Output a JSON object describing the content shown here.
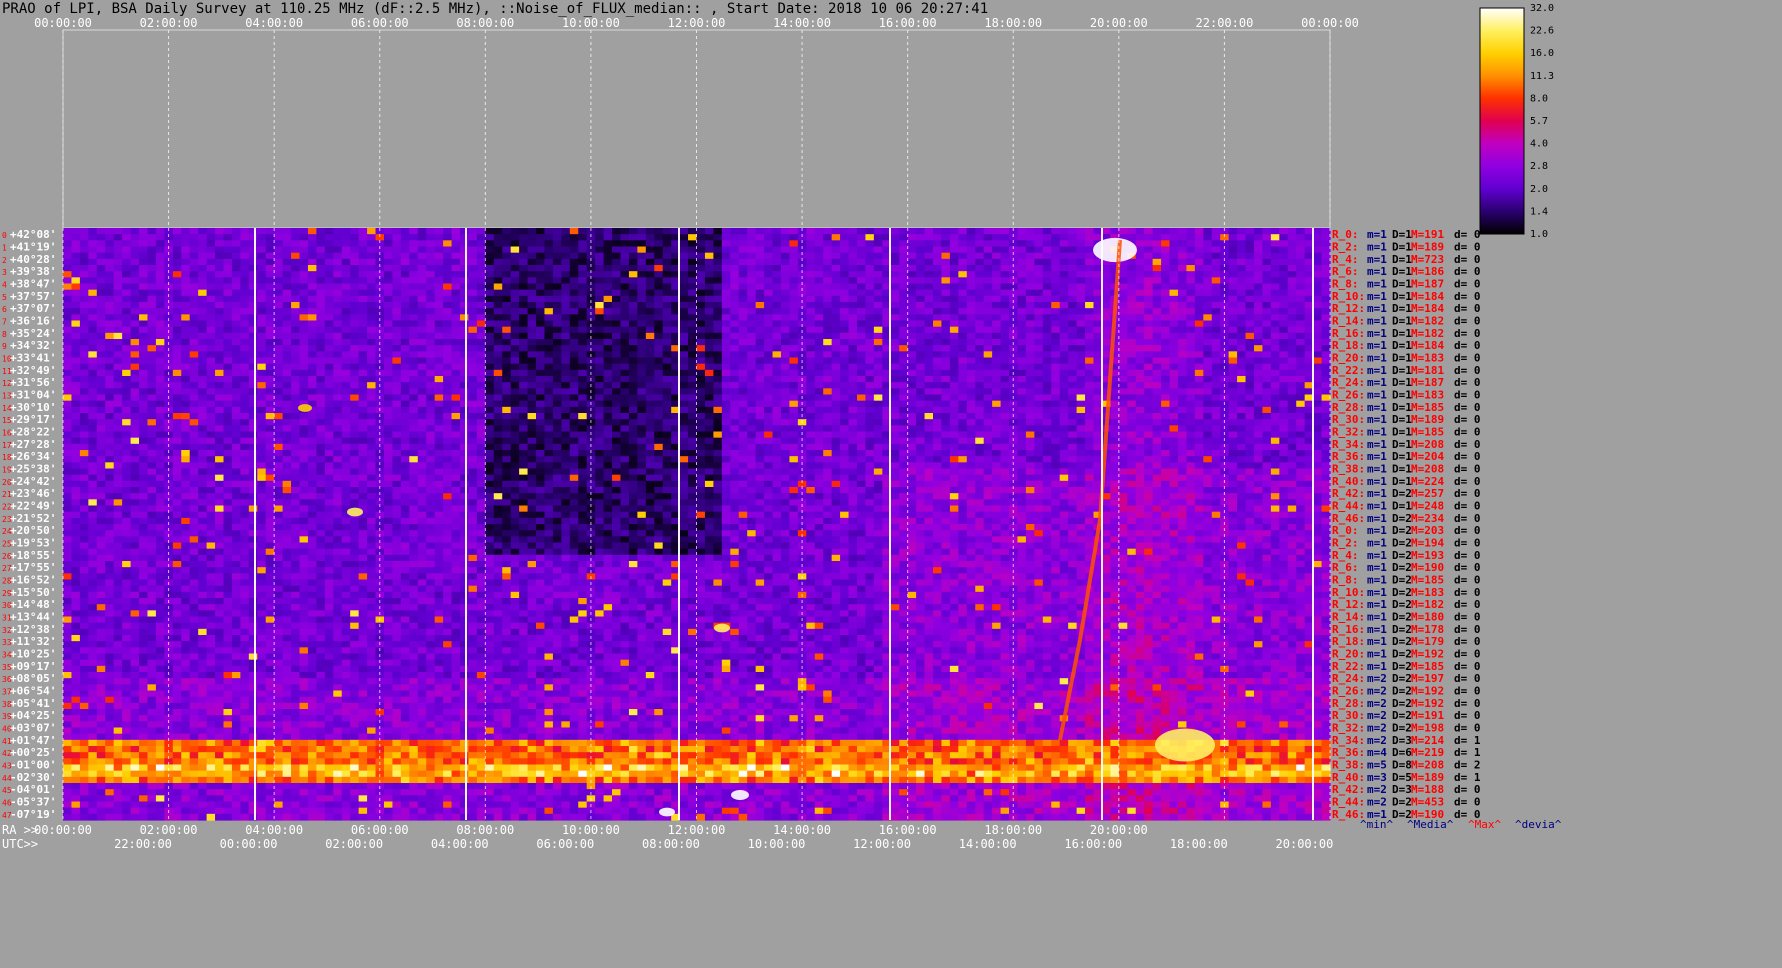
{
  "title": "PRAO of LPI, BSA Daily Survey at 110.25 MHz (dF::2.5 MHz), ::Noise_of_FLUX_median:: , Start Date: 2018 10 06 20:27:41",
  "chart_data": {
    "type": "heatmap",
    "x_top_ticks": [
      "00:00:00",
      "02:00:00",
      "04:00:00",
      "06:00:00",
      "08:00:00",
      "10:00:00",
      "12:00:00",
      "14:00:00",
      "16:00:00",
      "18:00:00",
      "20:00:00",
      "22:00:00",
      "00:00:00"
    ],
    "x_bottom_ra_label": "RA >>",
    "x_bottom_ra_ticks": [
      "00:00:00",
      "02:00:00",
      "04:00:00",
      "06:00:00",
      "08:00:00",
      "10:00:00",
      "12:00:00",
      "14:00:00",
      "16:00:00",
      "18:00:00",
      "20:00:00"
    ],
    "x_bottom_utc_label": "UTC>>",
    "x_bottom_utc_ticks": [
      "22:00:00",
      "00:00:00",
      "02:00:00",
      "04:00:00",
      "06:00:00",
      "08:00:00",
      "10:00:00",
      "12:00:00",
      "14:00:00",
      "16:00:00",
      "18:00:00",
      "20:00:00"
    ],
    "y_ticks": [
      "+42°08'",
      "+41°19'",
      "+40°28'",
      "+39°38'",
      "+38°47'",
      "+37°57'",
      "+37°07'",
      "+36°16'",
      "+35°24'",
      "+34°32'",
      "+33°41'",
      "+32°49'",
      "+31°56'",
      "+31°04'",
      "+30°10'",
      "+29°17'",
      "+28°22'",
      "+27°28'",
      "+26°34'",
      "+25°38'",
      "+24°42'",
      "+23°46'",
      "+22°49'",
      "+21°52'",
      "+20°50'",
      "+19°53'",
      "+18°55'",
      "+17°55'",
      "+16°52'",
      "+15°50'",
      "+14°48'",
      "+13°44'",
      "+12°38'",
      "+11°32'",
      "+10°25'",
      "+09°17'",
      "+08°05'",
      "+06°54'",
      "+05°41'",
      "+04°25'",
      "+03°07'",
      "+01°47'",
      "+00°25'",
      "-01°00'",
      "-02°30'",
      "-04°01'",
      "-05°37'",
      "-07°19'"
    ],
    "colorbar_ticks": [
      "32.0",
      "22.6",
      "16.0",
      "11.3",
      "8.0",
      "5.7",
      "4.0",
      "2.8",
      "2.0",
      "1.4",
      "1.0"
    ],
    "colorbar_colors": [
      "#ffffff",
      "#fff060",
      "#ffd000",
      "#ff9000",
      "#ff3000",
      "#e00050",
      "#c000c0",
      "#9000e0",
      "#6000d0",
      "#2a0070",
      "#000000"
    ],
    "right_footer": [
      {
        "text": "^min^",
        "color": "#000080"
      },
      {
        "text": "^Media^",
        "color": "#000080"
      },
      {
        "text": "^Max^",
        "color": "#ff0000"
      },
      {
        "text": "^devia^",
        "color": "#000080"
      }
    ],
    "rows": [
      {
        "r": "R_0:",
        "m": "m=1",
        "D": "D=1",
        "M": "M=191",
        "d": "d= 0"
      },
      {
        "r": "R_2:",
        "m": "m=1",
        "D": "D=1",
        "M": "M=189",
        "d": "d= 0"
      },
      {
        "r": "R_4:",
        "m": "m=1",
        "D": "D=1",
        "M": "M=723",
        "d": "d= 0"
      },
      {
        "r": "R_6:",
        "m": "m=1",
        "D": "D=1",
        "M": "M=186",
        "d": "d= 0"
      },
      {
        "r": "R_8:",
        "m": "m=1",
        "D": "D=1",
        "M": "M=187",
        "d": "d= 0"
      },
      {
        "r": "R_10:",
        "m": "m=1",
        "D": "D=1",
        "M": "M=184",
        "d": "d= 0"
      },
      {
        "r": "R_12:",
        "m": "m=1",
        "D": "D=1",
        "M": "M=184",
        "d": "d= 0"
      },
      {
        "r": "R_14:",
        "m": "m=1",
        "D": "D=1",
        "M": "M=182",
        "d": "d= 0"
      },
      {
        "r": "R_16:",
        "m": "m=1",
        "D": "D=1",
        "M": "M=182",
        "d": "d= 0"
      },
      {
        "r": "R_18:",
        "m": "m=1",
        "D": "D=1",
        "M": "M=184",
        "d": "d= 0"
      },
      {
        "r": "R_20:",
        "m": "m=1",
        "D": "D=1",
        "M": "M=183",
        "d": "d= 0"
      },
      {
        "r": "R_22:",
        "m": "m=1",
        "D": "D=1",
        "M": "M=181",
        "d": "d= 0"
      },
      {
        "r": "R_24:",
        "m": "m=1",
        "D": "D=1",
        "M": "M=187",
        "d": "d= 0"
      },
      {
        "r": "R_26:",
        "m": "m=1",
        "D": "D=1",
        "M": "M=183",
        "d": "d= 0"
      },
      {
        "r": "R_28:",
        "m": "m=1",
        "D": "D=1",
        "M": "M=185",
        "d": "d= 0"
      },
      {
        "r": "R_30:",
        "m": "m=1",
        "D": "D=1",
        "M": "M=189",
        "d": "d= 0"
      },
      {
        "r": "R_32:",
        "m": "m=1",
        "D": "D=1",
        "M": "M=185",
        "d": "d= 0"
      },
      {
        "r": "R_34:",
        "m": "m=1",
        "D": "D=1",
        "M": "M=208",
        "d": "d= 0"
      },
      {
        "r": "R_36:",
        "m": "m=1",
        "D": "D=1",
        "M": "M=204",
        "d": "d= 0"
      },
      {
        "r": "R_38:",
        "m": "m=1",
        "D": "D=1",
        "M": "M=208",
        "d": "d= 0"
      },
      {
        "r": "R_40:",
        "m": "m=1",
        "D": "D=1",
        "M": "M=224",
        "d": "d= 0"
      },
      {
        "r": "R_42:",
        "m": "m=1",
        "D": "D=2",
        "M": "M=257",
        "d": "d= 0"
      },
      {
        "r": "R_44:",
        "m": "m=1",
        "D": "D=1",
        "M": "M=248",
        "d": "d= 0"
      },
      {
        "r": "R_46:",
        "m": "m=1",
        "D": "D=2",
        "M": "M=234",
        "d": "d= 0"
      },
      {
        "r": "R_0:",
        "m": "m=1",
        "D": "D=2",
        "M": "M=203",
        "d": "d= 0"
      },
      {
        "r": "R_2:",
        "m": "m=1",
        "D": "D=2",
        "M": "M=194",
        "d": "d= 0"
      },
      {
        "r": "R_4:",
        "m": "m=1",
        "D": "D=2",
        "M": "M=193",
        "d": "d= 0"
      },
      {
        "r": "R_6:",
        "m": "m=1",
        "D": "D=2",
        "M": "M=190",
        "d": "d= 0"
      },
      {
        "r": "R_8:",
        "m": "m=1",
        "D": "D=2",
        "M": "M=185",
        "d": "d= 0"
      },
      {
        "r": "R_10:",
        "m": "m=1",
        "D": "D=2",
        "M": "M=183",
        "d": "d= 0"
      },
      {
        "r": "R_12:",
        "m": "m=1",
        "D": "D=2",
        "M": "M=182",
        "d": "d= 0"
      },
      {
        "r": "R_14:",
        "m": "m=1",
        "D": "D=2",
        "M": "M=180",
        "d": "d= 0"
      },
      {
        "r": "R_16:",
        "m": "m=1",
        "D": "D=2",
        "M": "M=178",
        "d": "d= 0"
      },
      {
        "r": "R_18:",
        "m": "m=1",
        "D": "D=2",
        "M": "M=179",
        "d": "d= 0"
      },
      {
        "r": "R_20:",
        "m": "m=1",
        "D": "D=2",
        "M": "M=192",
        "d": "d= 0"
      },
      {
        "r": "R_22:",
        "m": "m=1",
        "D": "D=2",
        "M": "M=185",
        "d": "d= 0"
      },
      {
        "r": "R_24:",
        "m": "m=2",
        "D": "D=2",
        "M": "M=197",
        "d": "d= 0"
      },
      {
        "r": "R_26:",
        "m": "m=2",
        "D": "D=2",
        "M": "M=192",
        "d": "d= 0"
      },
      {
        "r": "R_28:",
        "m": "m=2",
        "D": "D=2",
        "M": "M=192",
        "d": "d= 0"
      },
      {
        "r": "R_30:",
        "m": "m=2",
        "D": "D=2",
        "M": "M=191",
        "d": "d= 0"
      },
      {
        "r": "R_32:",
        "m": "m=2",
        "D": "D=2",
        "M": "M=198",
        "d": "d= 0"
      },
      {
        "r": "R_34:",
        "m": "m=2",
        "D": "D=3",
        "M": "M=214",
        "d": "d= 1"
      },
      {
        "r": "R_36:",
        "m": "m=4",
        "D": "D=6",
        "M": "M=219",
        "d": "d= 1"
      },
      {
        "r": "R_38:",
        "m": "m=5",
        "D": "D=8",
        "M": "M=208",
        "d": "d= 2"
      },
      {
        "r": "R_40:",
        "m": "m=3",
        "D": "D=5",
        "M": "M=189",
        "d": "d= 1"
      },
      {
        "r": "R_42:",
        "m": "m=2",
        "D": "D=3",
        "M": "M=188",
        "d": "d= 0"
      },
      {
        "r": "R_44:",
        "m": "m=2",
        "D": "D=2",
        "M": "M=453",
        "d": "d= 0"
      },
      {
        "r": "R_46:",
        "m": "m=1",
        "D": "D=2",
        "M": "M=190",
        "d": "d= 0"
      }
    ]
  }
}
